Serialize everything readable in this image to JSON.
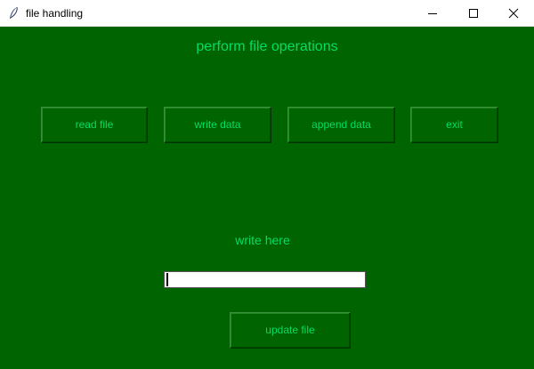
{
  "window": {
    "title": "file handling",
    "icon": "feather-icon",
    "controls": [
      "minimize-icon",
      "maximize-icon",
      "close-icon"
    ]
  },
  "colors": {
    "background": "#006400",
    "text": "#00dd66",
    "input_background": "#ffffff"
  },
  "main": {
    "heading": "perform file operations",
    "buttons": {
      "read": "read file",
      "write": "write data",
      "append": "append data",
      "exit": "exit"
    },
    "write_label": "write here",
    "input": {
      "value": "",
      "placeholder": ""
    },
    "update_button": "update file"
  }
}
